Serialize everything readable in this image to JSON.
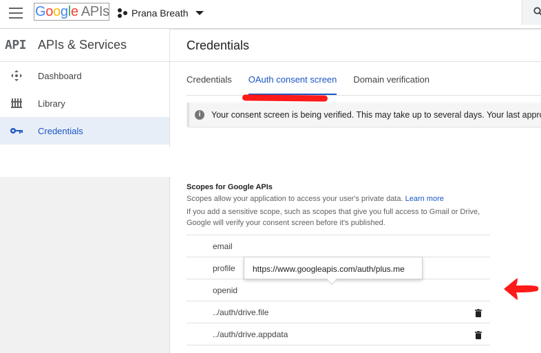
{
  "topbar": {
    "logo_google": "Google",
    "logo_apis": "APIs",
    "project_name": "Prana Breath"
  },
  "sidebar": {
    "api_mark": "API",
    "title": "APIs & Services",
    "items": [
      {
        "label": "Dashboard",
        "icon": "dashboard-icon",
        "active": false
      },
      {
        "label": "Library",
        "icon": "library-icon",
        "active": false
      },
      {
        "label": "Credentials",
        "icon": "key-icon",
        "active": true
      }
    ]
  },
  "main": {
    "title": "Credentials",
    "tabs": [
      {
        "label": "Credentials",
        "active": false
      },
      {
        "label": "OAuth consent screen",
        "active": true
      },
      {
        "label": "Domain verification",
        "active": false
      }
    ],
    "notice": "Your consent screen is being verified. This may take up to several days. Your last approved"
  },
  "scopes": {
    "title": "Scopes for Google APIs",
    "description": "Scopes allow your application to access your user's private data.",
    "learn_more": "Learn more",
    "note": "If you add a sensitive scope, such as scopes that give you full access to Gmail or Drive, Google will verify your consent screen before it's published.",
    "rows": [
      {
        "name": "email",
        "deletable": false
      },
      {
        "name": "profile",
        "deletable": false
      },
      {
        "name": "openid",
        "deletable": false
      },
      {
        "name": "../auth/drive.file",
        "deletable": true
      },
      {
        "name": "../auth/drive.appdata",
        "deletable": true
      }
    ],
    "tooltip": "https://www.googleapis.com/auth/plus.me"
  },
  "colors": {
    "accent": "#1a56c4",
    "annotation_red": "#ff1a1a",
    "active_bg": "#e8eef8"
  }
}
